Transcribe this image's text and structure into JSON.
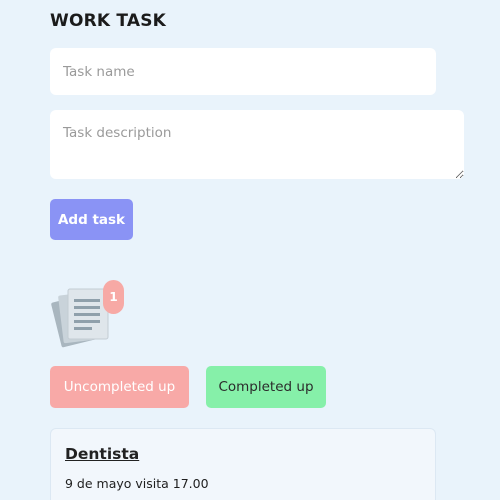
{
  "header": {
    "title": "WORK TASK"
  },
  "form": {
    "task_name_placeholder": "Task name",
    "task_description_placeholder": "Task description",
    "add_task_label": "Add task"
  },
  "notifications": {
    "icon": "documents-icon",
    "count": "1"
  },
  "filters": {
    "uncompleted_label": "Uncompleted up",
    "completed_label": "Completed up"
  },
  "tasks": [
    {
      "title": "Dentista",
      "description": "9 de mayo visita 17.00"
    }
  ],
  "colors": {
    "background": "#e9f3fb",
    "add_button": "#8a93f5",
    "uncompleted": "#f8a9a7",
    "completed": "#86f0a9",
    "badge": "#f7a9a5"
  }
}
